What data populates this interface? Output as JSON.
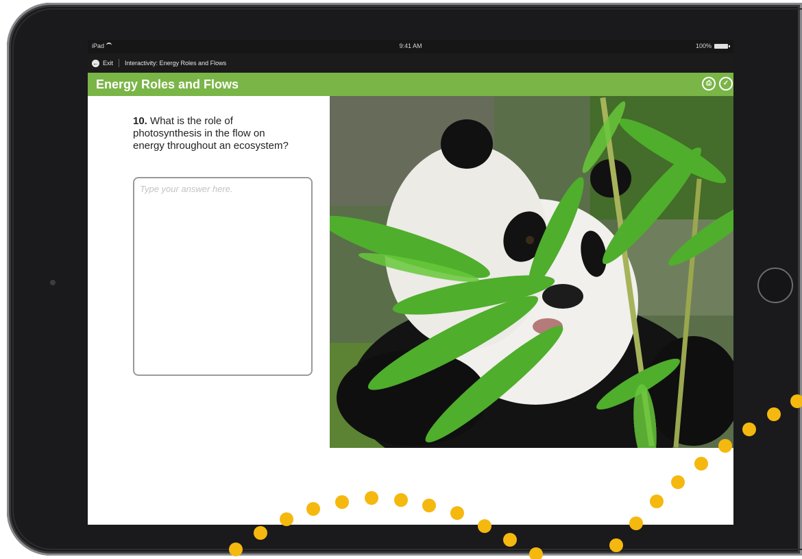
{
  "status_bar": {
    "carrier": "iPad",
    "time": "9:41 AM",
    "battery": "100%"
  },
  "nav": {
    "exit_label": "Exit",
    "breadcrumb": "Interactivity: Energy Roles and Flows"
  },
  "header": {
    "title": "Energy Roles and Flows",
    "icons": [
      "print-icon",
      "check-icon"
    ]
  },
  "question": {
    "number": "10.",
    "text": "What is the role of photosynthesis in the flow on energy throughout an ecosystem?"
  },
  "answer": {
    "placeholder": "Type your answer here."
  },
  "colors": {
    "header_green": "#7ab547",
    "accent_yellow": "#f5b80e",
    "device_bezel": "#1a1a1c"
  }
}
